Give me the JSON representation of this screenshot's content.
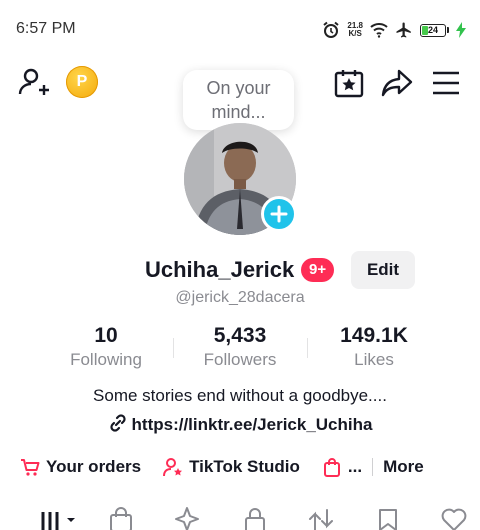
{
  "status": {
    "time": "6:57 PM",
    "net_speed_value": "21.8",
    "net_speed_unit": "K/S",
    "battery": "24",
    "battery_level": 0.24
  },
  "header": {
    "add_friend_icon": "person-plus-icon",
    "coin_letter": "P",
    "icons": [
      "calendar-star-icon",
      "share-arrow-icon",
      "menu-icon"
    ]
  },
  "bubble": {
    "text": "On your\nmind..."
  },
  "profile": {
    "username": "Uchiha_Jerick",
    "badge": "9+",
    "edit_label": "Edit",
    "handle": "@jerick_28dacera"
  },
  "stats": [
    {
      "value": "10",
      "label": "Following"
    },
    {
      "value": "5,433",
      "label": "Followers"
    },
    {
      "value": "149.1K",
      "label": "Likes"
    }
  ],
  "bio": "Some stories end without a goodbye....",
  "link": "https://linktr.ee/Jerick_Uchiha",
  "actions": {
    "orders": "Your orders",
    "studio": "TikTok Studio",
    "ellipsis": "...",
    "more": "More"
  },
  "colors": {
    "accent": "#fe2c55",
    "add_button": "#20c3ea",
    "coin": "#f6b10e"
  },
  "tabs": [
    "grid-icon",
    "shop-bag-icon",
    "sparkle-icon",
    "lock-icon",
    "repost-icon",
    "bookmark-icon",
    "heart-icon"
  ]
}
